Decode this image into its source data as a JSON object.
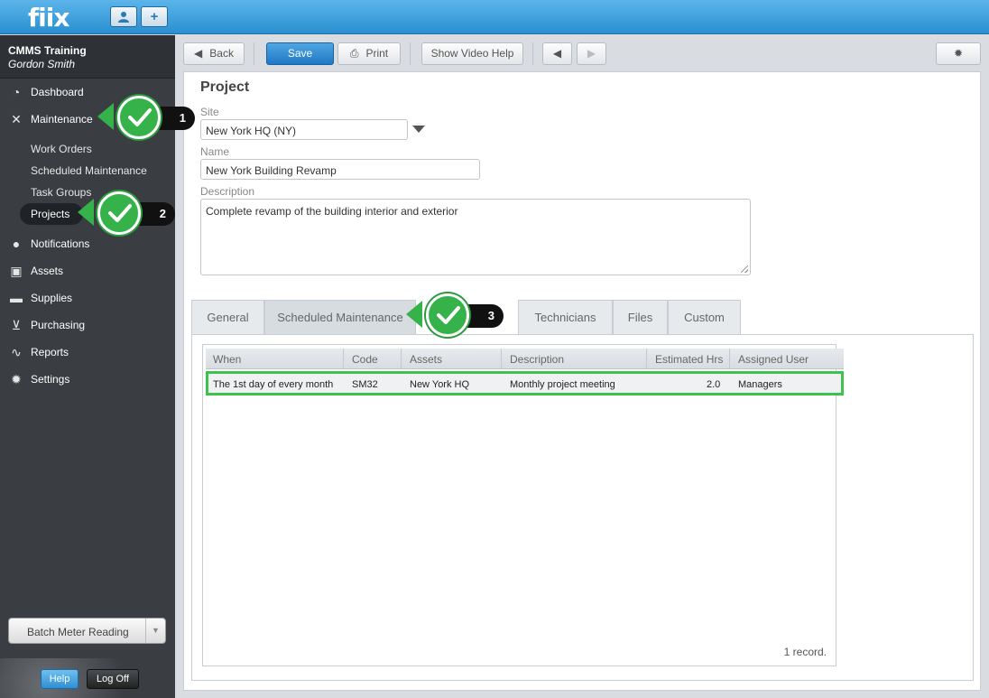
{
  "topbar": {
    "logo": "fiix",
    "user_btn_icon": "user-icon",
    "add_btn_label": "+"
  },
  "sidebar": {
    "org": "CMMS Training",
    "user": "Gordon Smith",
    "items": [
      {
        "label": "Dashboard",
        "icon": "dashboard-icon"
      },
      {
        "label": "Maintenance",
        "icon": "tools-icon"
      },
      {
        "label": "Notifications",
        "icon": "chat-icon"
      },
      {
        "label": "Assets",
        "icon": "box-icon"
      },
      {
        "label": "Supplies",
        "icon": "truck-icon"
      },
      {
        "label": "Purchasing",
        "icon": "cart-icon"
      },
      {
        "label": "Reports",
        "icon": "chart-icon"
      },
      {
        "label": "Settings",
        "icon": "gear-icon"
      }
    ],
    "subitems": [
      "Work Orders",
      "Scheduled Maintenance",
      "Task Groups",
      "Projects"
    ],
    "batch_label": "Batch Meter Reading",
    "help_label": "Help",
    "logoff_label": "Log Off"
  },
  "toolbar": {
    "back": "Back",
    "save": "Save",
    "print": "Print",
    "video_help": "Show Video Help"
  },
  "form": {
    "title": "Project",
    "site_label": "Site",
    "site_value": "New York HQ (NY)",
    "name_label": "Name",
    "name_value": "New York Building Revamp",
    "description_label": "Description",
    "description_value": "Complete revamp of the building interior and exterior"
  },
  "tabs": [
    "General",
    "Scheduled Maintenance",
    "Technicians",
    "Files",
    "Custom"
  ],
  "grid": {
    "columns": [
      "When",
      "Code",
      "Assets",
      "Description",
      "Estimated Hrs",
      "Assigned User"
    ],
    "rows": [
      {
        "when": "The 1st day of every month",
        "code": "SM32",
        "assets": "New York HQ",
        "description": "Monthly project meeting",
        "hours": "2.0",
        "user": "Managers"
      }
    ],
    "records": "1 record."
  },
  "callouts": [
    "1",
    "2",
    "3"
  ],
  "colors": {
    "accent": "#2a8fd0",
    "highlight": "#3cc24d"
  }
}
